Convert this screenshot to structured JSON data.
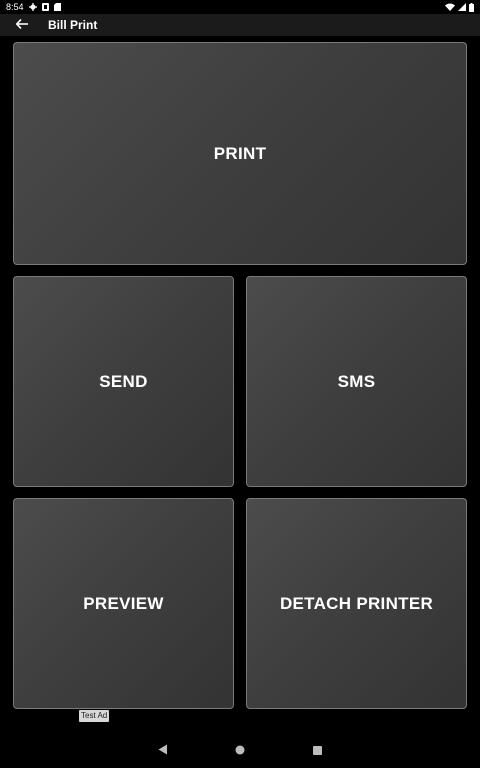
{
  "status_bar": {
    "time": "8:54",
    "icons": [
      "gear-icon",
      "notification-icon",
      "sd-card-icon",
      "wifi-icon",
      "signal-icon",
      "battery-icon"
    ]
  },
  "app_bar": {
    "title": "Bill Print",
    "back_icon": "arrow-left-icon"
  },
  "tiles": {
    "print": "PRINT",
    "send": "SEND",
    "sms": "SMS",
    "preview": "PREVIEW",
    "detach_printer": "DETACH PRINTER"
  },
  "ad": {
    "label": "Test Ad"
  },
  "nav_bar": {
    "icons": [
      "back-triangle-icon",
      "home-circle-icon",
      "recents-square-icon"
    ]
  },
  "colors": {
    "background": "#000000",
    "app_bar": "#1b1b1b",
    "tile_border": "#7a7a7a",
    "tile_fill": "#404040"
  }
}
